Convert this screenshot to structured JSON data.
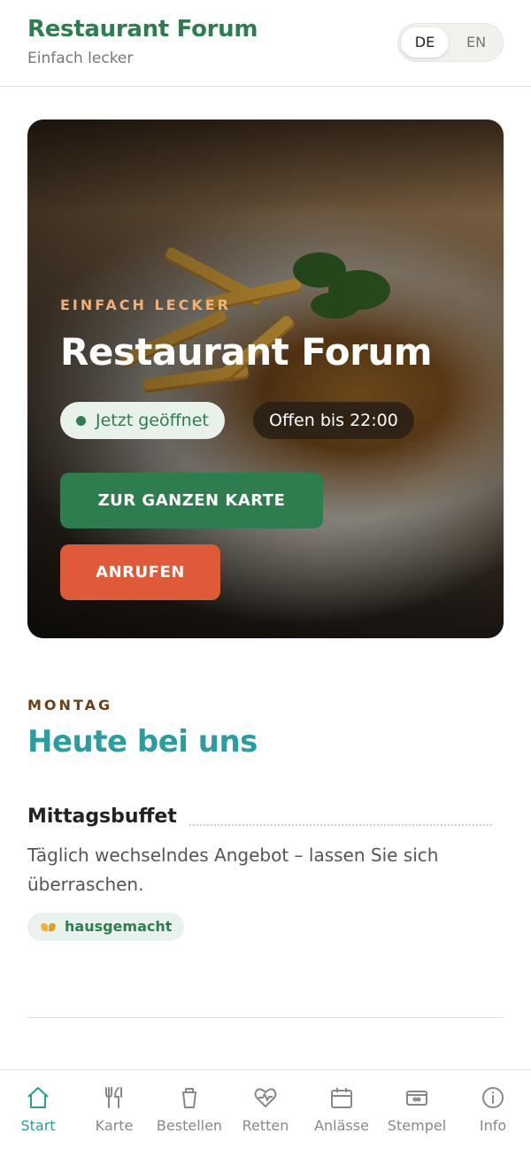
{
  "header": {
    "title": "Restaurant Forum",
    "subtitle": "Einfach lecker",
    "languages": [
      {
        "code": "DE",
        "active": true
      },
      {
        "code": "EN",
        "active": false
      }
    ]
  },
  "hero": {
    "eyebrow": "EINFACH LECKER",
    "title": "Restaurant Forum",
    "status": "Jetzt geöffnet",
    "hours": "Offen bis 22:00",
    "menu_button": "ZUR GANZEN KARTE",
    "call_button": "ANRUFEN"
  },
  "today": {
    "day": "MONTAG",
    "title": "Heute bei uns",
    "dish": {
      "name": "Mittagsbuffet",
      "description": "Täglich wechselndes Angebot – lassen Sie sich überraschen.",
      "tag": "hausgemacht"
    }
  },
  "nav": [
    {
      "label": "Start",
      "icon": "home-icon",
      "active": true
    },
    {
      "label": "Karte",
      "icon": "cutlery-icon",
      "active": false
    },
    {
      "label": "Bestellen",
      "icon": "cup-icon",
      "active": false
    },
    {
      "label": "Retten",
      "icon": "heart-pulse-icon",
      "active": false
    },
    {
      "label": "Anlässe",
      "icon": "calendar-icon",
      "active": false
    },
    {
      "label": "Stempel",
      "icon": "stamp-card-icon",
      "active": false
    },
    {
      "label": "Info",
      "icon": "info-icon",
      "active": false
    }
  ],
  "colors": {
    "brand_green": "#2e7d4f",
    "accent_teal": "#2a9d9f",
    "call_red": "#e05a3a",
    "eyebrow_orange": "#f0b07a"
  }
}
